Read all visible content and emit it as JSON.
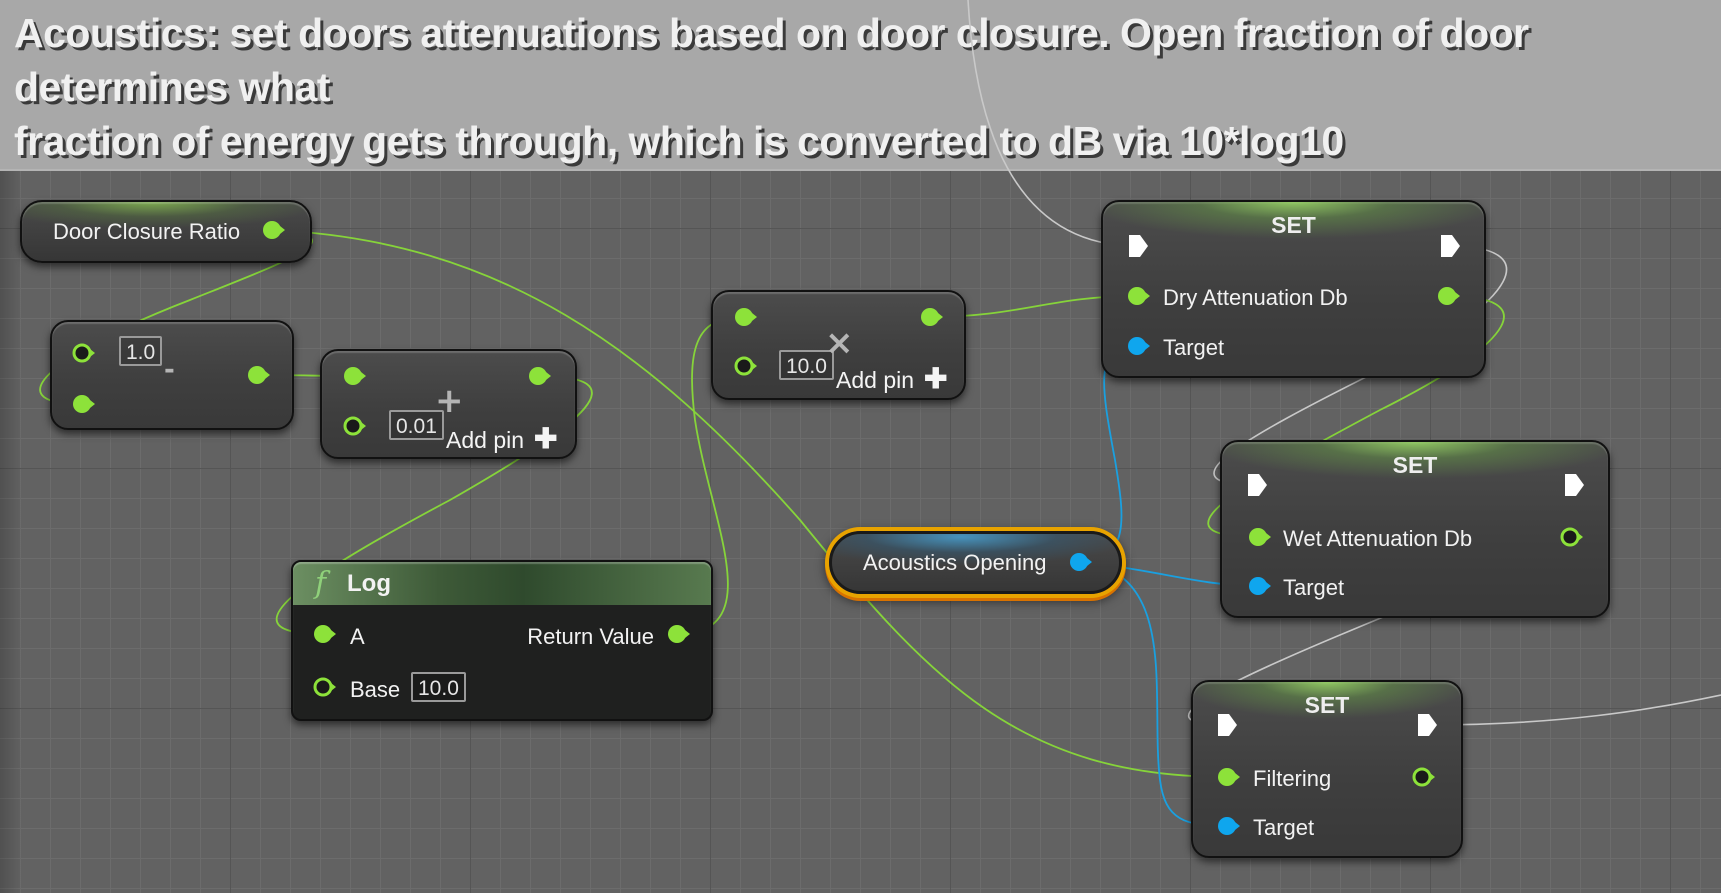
{
  "comment": {
    "lines": [
      "Acoustics: set doors attenuations based on door closure. Open fraction of door",
      "determines what",
      "fraction of energy gets through, which is converted to dB via 10*log10"
    ]
  },
  "colors": {
    "float_pin": "#8de23a",
    "object_pin": "#0fa6ee",
    "exec_pin": "#ffffff",
    "selection_outline": "#e8a300",
    "comment_bg": "#a8a8a8",
    "grid_bg": "#626262"
  },
  "nodes": {
    "door_closure_ratio": {
      "label": "Door Closure Ratio",
      "type": "variable-get"
    },
    "subtract": {
      "operator": "-",
      "input_a_default": "1.0"
    },
    "add": {
      "operator": "+",
      "input_b_default": "0.01",
      "add_pin_label": "Add pin"
    },
    "multiply": {
      "operator": "×",
      "input_b_default": "10.0",
      "add_pin_label": "Add pin"
    },
    "log": {
      "title": "Log",
      "icon": "function-icon",
      "pins": {
        "a": "A",
        "base": "Base",
        "return_value": "Return Value"
      },
      "base_default": "10.0"
    },
    "acoustics_opening": {
      "label": "Acoustics Opening",
      "type": "variable-get",
      "selected": true
    },
    "set_dry": {
      "title": "SET",
      "value_label": "Dry Attenuation Db",
      "target_label": "Target"
    },
    "set_wet": {
      "title": "SET",
      "value_label": "Wet Attenuation Db",
      "target_label": "Target"
    },
    "set_filtering": {
      "title": "SET",
      "value_label": "Filtering",
      "target_label": "Target"
    }
  }
}
